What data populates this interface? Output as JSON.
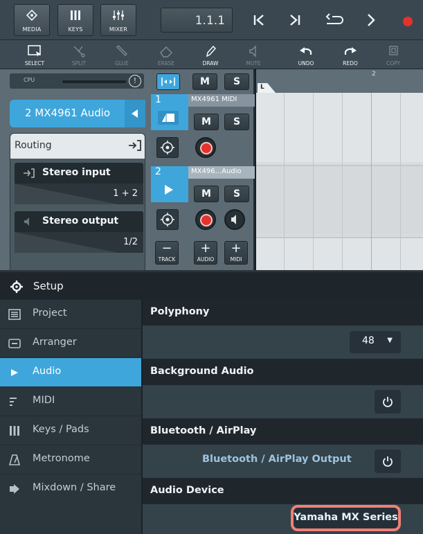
{
  "toolbar": {
    "media_label": "MEDIA",
    "keys_label": "KEYS",
    "mixer_label": "MIXER",
    "position": "1.1.1"
  },
  "tools": {
    "select": "SELECT",
    "split": "SPLIT",
    "glue": "GLUE",
    "erase": "ERASE",
    "draw": "DRAW",
    "mute": "MUTE",
    "undo": "UNDO",
    "redo": "REDO",
    "copy": "COPY"
  },
  "inspector": {
    "cpu_label": "CPU",
    "track_title": "2 MX4961 Audio",
    "routing_title": "Routing",
    "input_label": "Stereo input",
    "input_value": "1 + 2",
    "output_label": "Stereo output",
    "output_value": "1/2"
  },
  "tracks": [
    {
      "number": "1",
      "name": "MX4961 MIDI"
    },
    {
      "number": "2",
      "name": "MX496...Audio"
    }
  ],
  "track_buttons": {
    "mute": "M",
    "solo": "S",
    "track_label": "TRACK",
    "audio_label": "AUDIO",
    "midi_label": "MIDI"
  },
  "ruler": {
    "bar2": "2",
    "locator": "L"
  },
  "setup": {
    "title": "Setup",
    "sidebar": [
      {
        "label": "Project",
        "icon": "list-icon"
      },
      {
        "label": "Arranger",
        "icon": "arranger-icon"
      },
      {
        "label": "Audio",
        "icon": "play-icon"
      },
      {
        "label": "MIDI",
        "icon": "midi-icon"
      },
      {
        "label": "Keys / Pads",
        "icon": "keys-icon"
      },
      {
        "label": "Metronome",
        "icon": "metronome-icon"
      },
      {
        "label": "Mixdown / Share",
        "icon": "share-icon"
      }
    ],
    "sections": {
      "polyphony_title": "Polyphony",
      "polyphony_value": "48",
      "background_audio_title": "Background Audio",
      "bluetooth_title": "Bluetooth / AirPlay",
      "bluetooth_output_label": "Bluetooth / AirPlay Output",
      "audio_device_title": "Audio Device",
      "audio_device_value": "Yamaha MX Series"
    }
  },
  "colors": {
    "accent": "#3fa6dc",
    "record": "#e5322d",
    "highlight_border": "#f08077"
  }
}
